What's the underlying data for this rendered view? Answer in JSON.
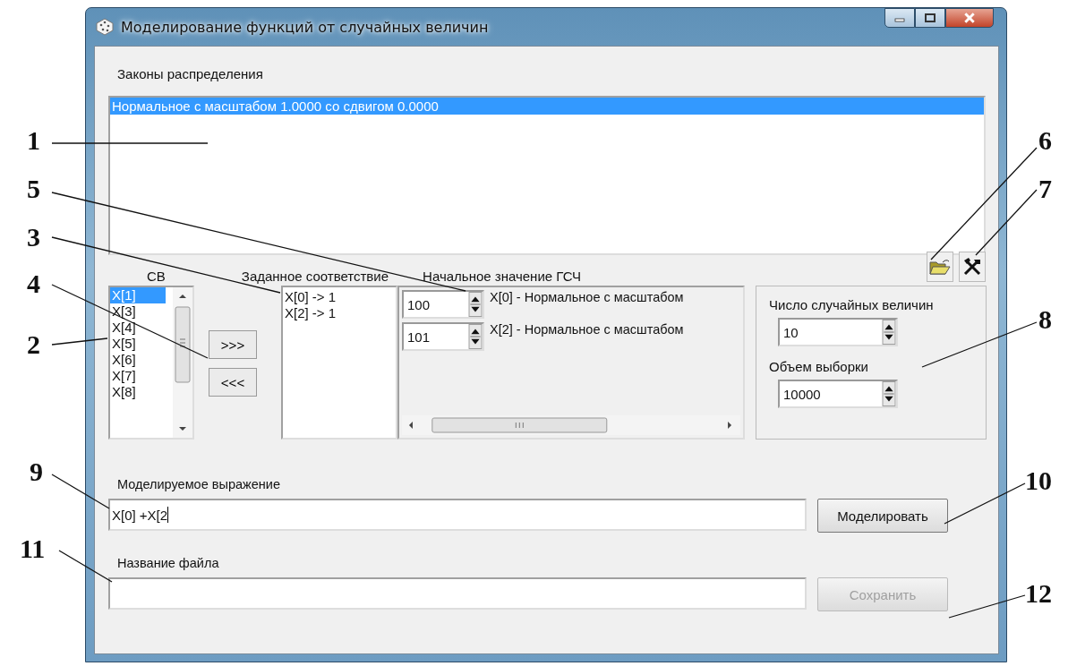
{
  "window": {
    "title": "Моделирование функций от случайных величин"
  },
  "distribution_laws": {
    "label": "Законы распределения",
    "items": [
      {
        "text": "Нормальное с масштабом 1.0000 со сдвигом 0.0000",
        "selected": true
      }
    ]
  },
  "random_variables": {
    "label": "СВ",
    "items": [
      {
        "text": "X[1]",
        "selected": true
      },
      {
        "text": "X[3]",
        "selected": false
      },
      {
        "text": "X[4]",
        "selected": false
      },
      {
        "text": "X[5]",
        "selected": false
      },
      {
        "text": "X[6]",
        "selected": false
      },
      {
        "text": "X[7]",
        "selected": false
      },
      {
        "text": "X[8]",
        "selected": false
      }
    ]
  },
  "move_buttons": [
    ">>>",
    "<<<"
  ],
  "mapping": {
    "label": "Заданное соответствие",
    "items": [
      "X[0] -> 1",
      "X[2] -> 1"
    ]
  },
  "seeds": {
    "label": "Начальное значение ГСЧ",
    "rows": [
      {
        "value": "100",
        "text": "X[0] - Нормальное с масштабом"
      },
      {
        "value": "101",
        "text": "X[2] - Нормальное с масштабом"
      }
    ]
  },
  "settings": {
    "count_label": "Число случайных величин",
    "count": "10",
    "sample_label": "Объем выборки",
    "sample": "10000"
  },
  "expression": {
    "label": "Моделируемое выражение",
    "value": "X[0] +X[2"
  },
  "model_button": {
    "label": "Моделировать",
    "disabled": false
  },
  "file": {
    "label": "Название файла"
  },
  "save_button": {
    "label": "Сохранить",
    "disabled": true
  },
  "callouts": [
    {
      "label": "1"
    },
    {
      "label": "6"
    },
    {
      "label": "5"
    },
    {
      "label": "7"
    },
    {
      "label": "3"
    },
    {
      "label": "4"
    },
    {
      "label": "8"
    },
    {
      "label": "2"
    },
    {
      "label": "9"
    },
    {
      "label": "10"
    },
    {
      "label": "11"
    },
    {
      "label": "12"
    }
  ]
}
